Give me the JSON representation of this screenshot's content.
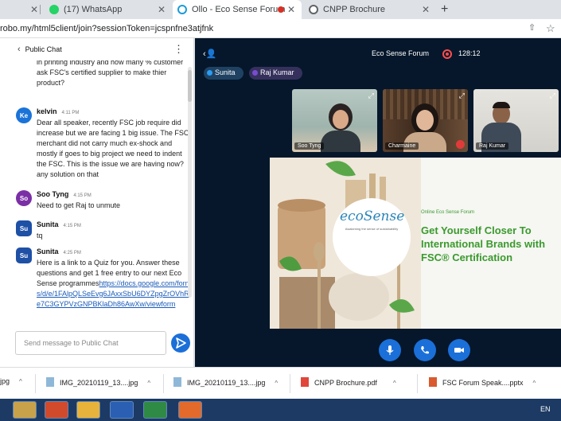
{
  "tabs": [
    {
      "label": "(17) WhatsApp",
      "active": false
    },
    {
      "label": "Ollo - Eco Sense Forum",
      "active": true
    },
    {
      "label": "CNPP Brochure",
      "active": false
    }
  ],
  "address": {
    "url": "robo.my/html5client/join?sessionToken=jcspnfne3atjfnk"
  },
  "chat": {
    "title": "Public Chat",
    "messages": [
      {
        "name": "",
        "time": "",
        "initials": "",
        "text": "in printing industry and how many % customer ask FSC's certified supplier to make thier product?"
      },
      {
        "name": "kelvin",
        "time": "4:11 PM",
        "initials": "Ke",
        "text": "Dear all speaker, recently FSC job require did increase but we are facing 1 big issue. The FSC merchant did not carry much ex-shock and mostly if goes to big project we need to indent the FSC. This is the issue we are having now? any solution on that"
      },
      {
        "name": "Soo Tyng",
        "time": "4:15 PM",
        "initials": "So",
        "text": "Need to get Raj to unmute"
      },
      {
        "name": "Sunita",
        "time": "4:15 PM",
        "initials": "Su",
        "text": "tq"
      },
      {
        "name": "Sunita",
        "time": "4:25 PM",
        "initials": "Su",
        "text": "Here is a link to a Quiz for you. Answer these questions and get 1 free entry to our next Eco Sense programmes",
        "link": "https://docs.google.com/forms/d/e/1FAlpQLSeEvg6JAxxSbU6DYZpgZrOVhRe7C3GYPVzGNPBKlaDh86AwXw/viewform"
      }
    ],
    "input_placeholder": "Send message to Public Chat"
  },
  "meeting": {
    "room_name": "Eco Sense Forum",
    "timer": "128:12",
    "presenters": [
      "Sunita",
      "Raj Kumar"
    ],
    "participants": [
      {
        "name": "Soo Tyng"
      },
      {
        "name": "Charmaine"
      },
      {
        "name": "Raj Kumar"
      }
    ],
    "slide": {
      "kicker": "Online Eco Sense Forum",
      "headline": "Get Yourself Closer To International Brands with FSC® Certification",
      "logo_word": "ecoSense",
      "logo_tagline": "Awakening the sense of sustainability"
    }
  },
  "downloads": [
    {
      "name": "IMG_20210119_13....jpg"
    },
    {
      "name": "IMG_20210119_13....jpg"
    },
    {
      "name": "CNPP Brochure.pdf"
    },
    {
      "name": "FSC Forum Speak....pptx"
    }
  ],
  "taskbar": {
    "language": "EN"
  },
  "colors": {
    "accent": "#1b6fd8",
    "meeting_bg": "#06172b",
    "headline_green": "#3a9a2c"
  }
}
